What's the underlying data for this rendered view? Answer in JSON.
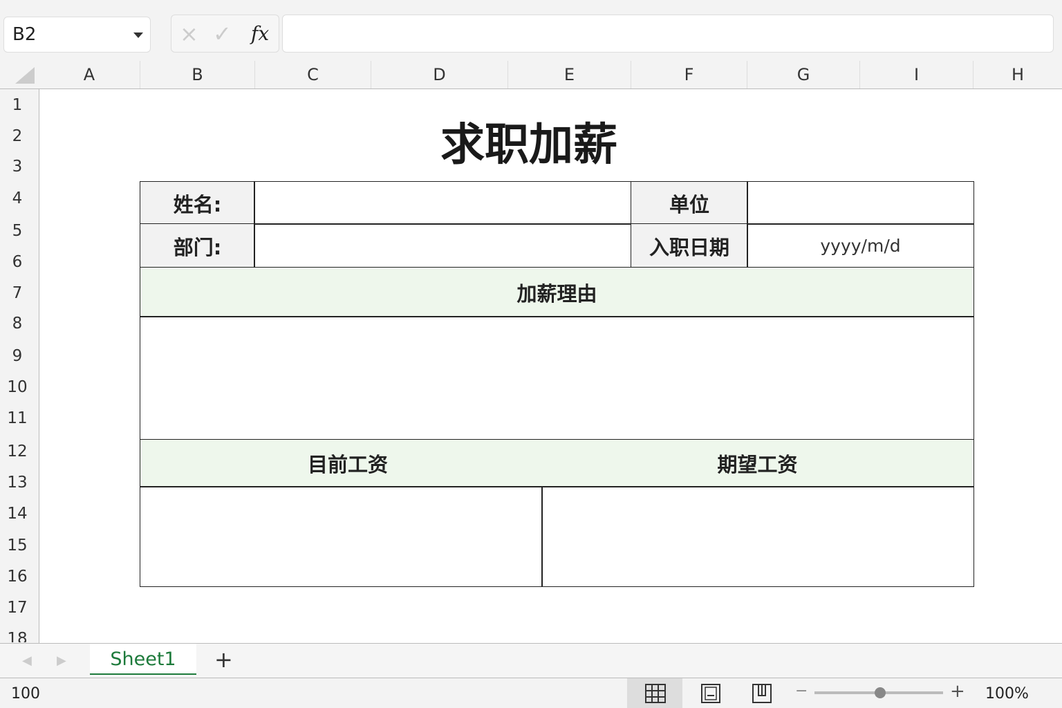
{
  "name_box": {
    "value": "B2"
  },
  "formula_bar": {
    "cancel_icon": "×",
    "enter_icon": "✓",
    "fx_label": "fx",
    "value": ""
  },
  "columns": [
    "A",
    "B",
    "C",
    "D",
    "E",
    "F",
    "G",
    "I",
    "H"
  ],
  "rows": [
    "1",
    "2",
    "3",
    "4",
    "5",
    "6",
    "7",
    "8",
    "9",
    "10",
    "11",
    "12",
    "13",
    "14",
    "15",
    "16",
    "17",
    "18"
  ],
  "form": {
    "title": "求职加薪",
    "name_label": "姓名:",
    "name_value": "",
    "unit_label": "单位",
    "unit_value": "",
    "dept_label": "部门:",
    "dept_value": "",
    "hire_date_label": "入职日期",
    "hire_date_value": "yyyy/m/d",
    "reason_header": "加薪理由",
    "reason_value": "",
    "current_salary_header": "目前工资",
    "expected_salary_header": "期望工资"
  },
  "sheet_tabs": {
    "active": "Sheet1",
    "add_label": "+"
  },
  "status": {
    "left_text": "100",
    "zoom": "100%",
    "zoom_fraction": 0.5,
    "minus": "−",
    "plus": "+"
  }
}
